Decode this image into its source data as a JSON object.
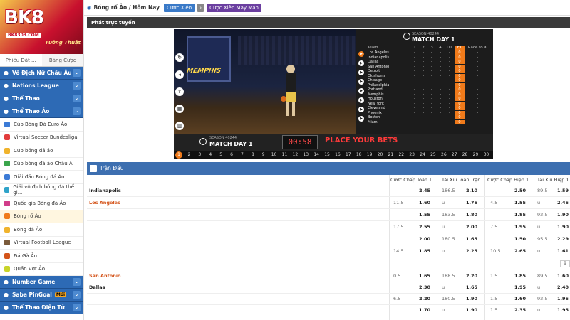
{
  "logo": {
    "brand": "BK8",
    "sub": "BK8303.COM",
    "tag": "Tướng Thuật"
  },
  "sidebar": {
    "tabs": [
      "Phiếu Đặt ...",
      "Bảng Cược"
    ],
    "categories_top": [
      {
        "label": "Vô Địch Nữ Châu Âu",
        "icon": "trophy-icon"
      },
      {
        "label": "Nations League",
        "icon": "nations-icon"
      },
      {
        "label": "Thể Thao",
        "icon": "sports-icon"
      },
      {
        "label": "Thể Thao Ảo",
        "icon": "virtual-sports-icon"
      }
    ],
    "virtual_items": [
      {
        "label": "Cúp Bóng Đá Euro Ảo",
        "color": "#3c7bd6"
      },
      {
        "label": "Virtual Soccer Bundesliga",
        "color": "#e23c3c"
      },
      {
        "label": "Cúp bóng đá ảo",
        "color": "#f0b32c"
      },
      {
        "label": "Cúp bóng đá ảo Châu Á",
        "color": "#3aa54b"
      },
      {
        "label": "Giải đấu Bóng đá Ảo",
        "color": "#3c7bd6"
      },
      {
        "label": "Giải vô địch bóng đá thế gi...",
        "color": "#2fa3c9"
      },
      {
        "label": "Quốc gia Bóng đá Ảo",
        "color": "#d13d8a"
      },
      {
        "label": "Bóng rổ Ảo",
        "color": "#f07a1a"
      },
      {
        "label": "Bóng đá Ảo",
        "color": "#f0b32c"
      },
      {
        "label": "Virtual Football League",
        "color": "#7a5a3a"
      },
      {
        "label": "Đá Gà Ảo",
        "color": "#d4541a"
      },
      {
        "label": "Quần Vợt Ảo",
        "color": "#c8d42a"
      }
    ],
    "active_item": "Bóng rổ Ảo",
    "categories_bottom": [
      {
        "label": "Number Game",
        "icon": "number-game-icon",
        "badge": ""
      },
      {
        "label": "Saba PinGoal",
        "icon": "pingoal-icon",
        "badge": "Mới"
      },
      {
        "label": "Thể Thao Điện Tử",
        "icon": "esports-icon",
        "badge": ""
      }
    ]
  },
  "topbar": {
    "crumb": "Bóng rổ Ảo / Hôm Nay",
    "pill1": "Cược Xiên",
    "pill2_icon": "chevron-right-icon",
    "pill3": "Cược Xiên May Mắn"
  },
  "livebar": {
    "title": "Phát trực tuyến"
  },
  "video": {
    "team_banner": "MEMPHIS",
    "season": "SEASON 40244",
    "matchday": "MATCH DAY 1",
    "controls": [
      "refresh-icon",
      "volume-icon",
      "share-icon",
      "grid-icon",
      "chart-icon"
    ],
    "scoreboard_cols": [
      "Team",
      "1",
      "2",
      "3",
      "4",
      "OT",
      "FT",
      "Race to X"
    ],
    "scoreboard_rows": [
      [
        "Los Angeles",
        "0"
      ],
      [
        "Indianapolis",
        "0"
      ],
      [
        "Dallas",
        "0"
      ],
      [
        "San Antonio",
        "0"
      ],
      [
        "Detroit",
        "0"
      ],
      [
        "Oklahoma",
        "0"
      ],
      [
        "Chicago",
        "0"
      ],
      [
        "Philadelphia",
        "0"
      ],
      [
        "Portland",
        "0"
      ],
      [
        "Memphis",
        "0"
      ],
      [
        "Houston",
        "0"
      ],
      [
        "New York",
        "0"
      ],
      [
        "Cleveland",
        "0"
      ],
      [
        "Phoenix",
        "0"
      ],
      [
        "Boston",
        "0"
      ],
      [
        "Miami",
        "0"
      ]
    ],
    "timer": "00:58",
    "place_bets": "PLACE YOUR BETS",
    "round_numbers": [
      "1",
      "2",
      "3",
      "4",
      "5",
      "6",
      "7",
      "8",
      "9",
      "10",
      "11",
      "12",
      "13",
      "14",
      "15",
      "16",
      "17",
      "18",
      "19",
      "20",
      "21",
      "22",
      "23",
      "24",
      "25",
      "26",
      "27",
      "28",
      "29",
      "30"
    ]
  },
  "match": {
    "header": "Trận Đấu",
    "columns": [
      "Cược Chấp Toàn T...",
      "Tài Xỉu Toàn Trận",
      "Cược Chấp Hiệp 1",
      "Tài Xỉu Hiệp 1"
    ],
    "pager": "9",
    "rows": [
      {
        "team": "Indianapolis",
        "red": false,
        "hc1": "",
        "o1": "2.45",
        "t1": "186.5",
        "o2": "2.10",
        "hc3": "",
        "o3": "2.50",
        "t4": "89.5",
        "o4": "1.59"
      },
      {
        "team": "Los Angeles",
        "red": true,
        "hc1": "11.5",
        "o1": "1.60",
        "t1": "u",
        "o2": "1.75",
        "hc3": "4.5",
        "o3": "1.55",
        "t4": "u",
        "o4": "2.45"
      },
      {
        "team": "",
        "red": false,
        "hc1": "",
        "o1": "1.55",
        "t1": "183.5",
        "o2": "1.80",
        "hc3": "",
        "o3": "1.85",
        "t4": "92.5",
        "o4": "1.90"
      },
      {
        "team": "",
        "red": false,
        "hc1": "17.5",
        "o1": "2.55",
        "t1": "u",
        "o2": "2.00",
        "hc3": "7.5",
        "o3": "1.95",
        "t4": "u",
        "o4": "1.90"
      },
      {
        "team": "",
        "red": false,
        "hc1": "",
        "o1": "2.00",
        "t1": "180.5",
        "o2": "1.65",
        "hc3": "",
        "o3": "1.50",
        "t4": "95.5",
        "o4": "2.29"
      },
      {
        "team": "",
        "red": false,
        "hc1": "14.5",
        "o1": "1.85",
        "t1": "u",
        "o2": "2.25",
        "hc3": "10.5",
        "o3": "2.65",
        "t4": "u",
        "o4": "1.61"
      },
      {
        "team": "San Antonio",
        "red": true,
        "hc1": "0.5",
        "o1": "1.65",
        "t1": "188.5",
        "o2": "2.20",
        "hc3": "1.5",
        "o3": "1.85",
        "t4": "89.5",
        "o4": "1.60"
      },
      {
        "team": "Dallas",
        "red": false,
        "hc1": "",
        "o1": "2.30",
        "t1": "u",
        "o2": "1.65",
        "hc3": "",
        "o3": "1.95",
        "t4": "u",
        "o4": "2.40"
      },
      {
        "team": "",
        "red": false,
        "hc1": "6.5",
        "o1": "2.20",
        "t1": "180.5",
        "o2": "1.90",
        "hc3": "1.5",
        "o3": "1.60",
        "t4": "92.5",
        "o4": "1.95"
      },
      {
        "team": "",
        "red": false,
        "hc1": "",
        "o1": "1.70",
        "t1": "u",
        "o2": "1.90",
        "hc3": "1.5",
        "o3": "2.35",
        "t4": "u",
        "o4": "1.95"
      }
    ]
  }
}
